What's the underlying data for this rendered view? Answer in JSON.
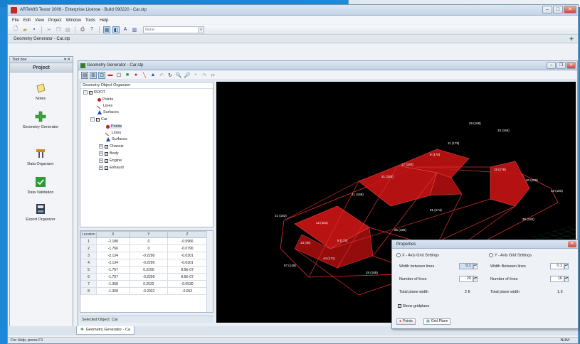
{
  "window": {
    "title": "ARTeMIS Testor 2009 - Enterprise License - Build 090220 - Car.stp"
  },
  "menu": [
    "File",
    "Edit",
    "View",
    "Project",
    "Window",
    "Tools",
    "Help"
  ],
  "toolbar": {
    "combo_value": "None"
  },
  "doc_bar": {
    "label": "Geometry Generator - Car.stp"
  },
  "toolbox": {
    "header": "Tool box",
    "project_label": "Project",
    "items": [
      {
        "label": "Notes",
        "icon": "notes-icon"
      },
      {
        "label": "Geometry Generator",
        "icon": "geometry-generator-icon"
      },
      {
        "label": "Data Organizer",
        "icon": "data-organizer-icon"
      },
      {
        "label": "Data Validation",
        "icon": "data-validation-icon"
      },
      {
        "label": "Export Organizer",
        "icon": "export-organizer-icon"
      }
    ]
  },
  "geometry_window": {
    "title": "Geometry Generator - Car.stp",
    "tree_header": "Geometry Object Organizer",
    "tree": [
      {
        "label": "ROOT",
        "level": 0
      },
      {
        "label": "Points",
        "level": 1,
        "icon": "points-icon"
      },
      {
        "label": "Lines",
        "level": 1,
        "icon": "lines-icon"
      },
      {
        "label": "Surfaces",
        "level": 1,
        "icon": "surfaces-icon"
      },
      {
        "label": "Car",
        "level": 1
      },
      {
        "label": "Points",
        "level": 2,
        "icon": "points-icon"
      },
      {
        "label": "Lines",
        "level": 2,
        "icon": "lines-icon"
      },
      {
        "label": "Surfaces",
        "level": 2,
        "icon": "surfaces-icon"
      },
      {
        "label": "Chassis",
        "level": 2
      },
      {
        "label": "Body",
        "level": 2
      },
      {
        "label": "Engine",
        "level": 2
      },
      {
        "label": "Exhaust",
        "level": 2
      }
    ],
    "table": {
      "headers": [
        "Location",
        "X",
        "Y",
        "Z"
      ],
      "rows": [
        [
          "1",
          "-2.188",
          "0",
          "-0.5966"
        ],
        [
          "2",
          "-1.766",
          "0",
          "-0.0790"
        ],
        [
          "3",
          "-2.134",
          "-0.2290",
          "-0.0301"
        ],
        [
          "4",
          "-2.134",
          "-0.2290",
          "-0.0301"
        ],
        [
          "5",
          "-1.707",
          "0.2290",
          "8.6E-07"
        ],
        [
          "6",
          "-1.707",
          "-0.2290",
          "8.6E-07"
        ],
        [
          "7",
          "-1.368",
          "0.2032",
          "-0.0530"
        ],
        [
          "8",
          "-1.368",
          "-0.2032",
          "-0.052"
        ]
      ]
    },
    "selected_object": "Selected Object: Car"
  },
  "properties": {
    "title": "Properties",
    "x_axis_title": "X - Axis Grid Settings",
    "y_axis_title": "Y - Axis Grid Settings",
    "x_width_label": "Width between lines",
    "x_width_value": "0.1",
    "x_number_label": "Number of lines",
    "x_number_value": "20",
    "x_total_label": "Total plane width",
    "x_total_value": "2 ft",
    "y_width_label": "Width Between lines",
    "y_width_value": "0.1",
    "y_number_label": "Number of lines",
    "y_number_value": "16",
    "y_total_label": "Total plane width",
    "y_total_value": "1.6",
    "show_gridplane": "Show gridplane",
    "tab_points": "Points",
    "tab_grid": "Grid Plane"
  },
  "doc_tab": "Geometry Generator - Ca",
  "status": {
    "left": "For Help, press F1",
    "right": "NUM"
  }
}
